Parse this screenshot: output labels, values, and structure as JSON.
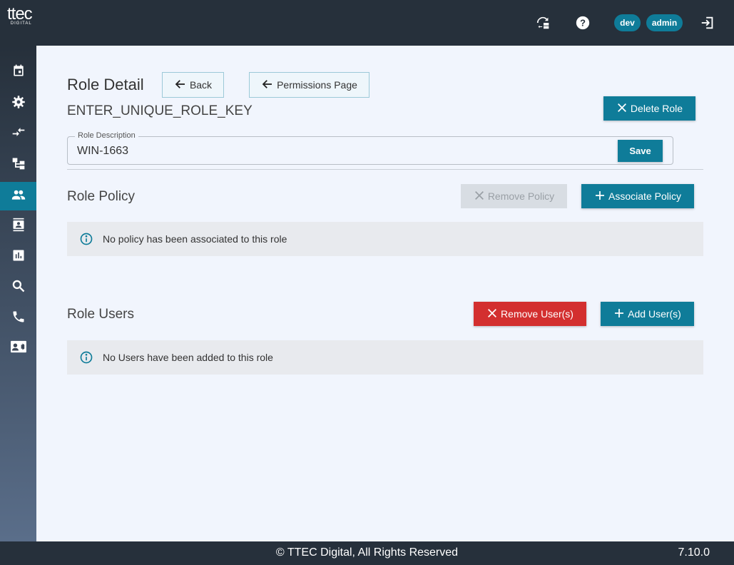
{
  "header": {
    "logo_text": "ttec",
    "logo_sub": "DIGITAL",
    "env_badge": "dev",
    "user_badge": "admin",
    "icons": [
      "switch-view-icon",
      "help-icon",
      "logout-icon"
    ]
  },
  "sidebar": {
    "items": [
      {
        "name": "calendar-icon"
      },
      {
        "name": "settings-gear-icon"
      },
      {
        "name": "compare-arrows-icon"
      },
      {
        "name": "hierarchy-icon"
      },
      {
        "name": "people-icon",
        "active": true
      },
      {
        "name": "contact-book-icon"
      },
      {
        "name": "bar-chart-icon"
      },
      {
        "name": "search-icon"
      },
      {
        "name": "phone-icon"
      },
      {
        "name": "contact-card-icon"
      }
    ]
  },
  "page": {
    "title": "Role Detail",
    "back_label": "Back",
    "permissions_label": "Permissions Page",
    "role_key": "ENTER_UNIQUE_ROLE_KEY",
    "delete_label": "Delete Role",
    "description_legend": "Role Description",
    "description_value": "WIN-1663",
    "save_label": "Save"
  },
  "policy": {
    "title": "Role Policy",
    "remove_label": "Remove Policy",
    "associate_label": "Associate Policy",
    "empty_message": "No policy has been associated to this role"
  },
  "users": {
    "title": "Role Users",
    "remove_label": "Remove User(s)",
    "add_label": "Add User(s)",
    "empty_message": "No Users have been added to this role"
  },
  "footer": {
    "copyright": "© TTEC Digital, All Rights Reserved",
    "version": "7.10.0"
  },
  "colors": {
    "accent": "#0f7c99",
    "danger": "#d32f2f",
    "topbar": "#26303b",
    "background": "#f1f5fd"
  }
}
